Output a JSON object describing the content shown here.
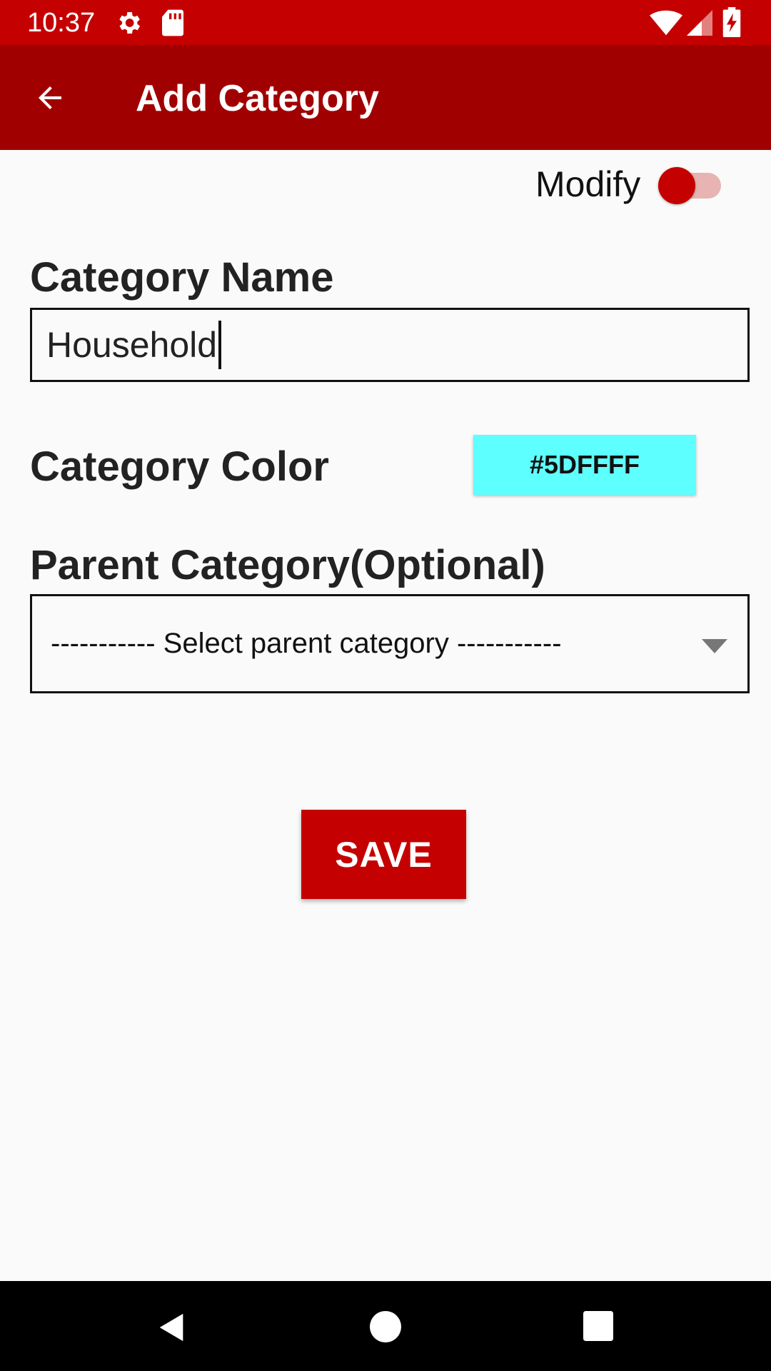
{
  "status_bar": {
    "time": "10:37",
    "icons": [
      "gear-icon",
      "sd-card-icon",
      "wifi-icon",
      "signal-icon",
      "battery-charging-icon"
    ]
  },
  "app_bar": {
    "title": "Add Category",
    "back_icon": "arrow-back-icon"
  },
  "modify": {
    "label": "Modify",
    "enabled": true,
    "accent": "#c50000"
  },
  "category_name": {
    "label": "Category Name",
    "value": "Household"
  },
  "category_color": {
    "label": "Category Color",
    "value": "#5DFFFF",
    "swatch_color": "#5dffff"
  },
  "parent_category": {
    "label": "Parent Category(Optional)",
    "selected": "----------- Select parent category -----------"
  },
  "save_button": {
    "label": "SAVE",
    "color": "#c50000"
  },
  "nav_bar": {
    "icons": [
      "nav-back-icon",
      "nav-home-icon",
      "nav-recents-icon"
    ]
  },
  "colors": {
    "status_bar": "#c50000",
    "app_bar": "#a10000",
    "background": "#fafafa"
  }
}
